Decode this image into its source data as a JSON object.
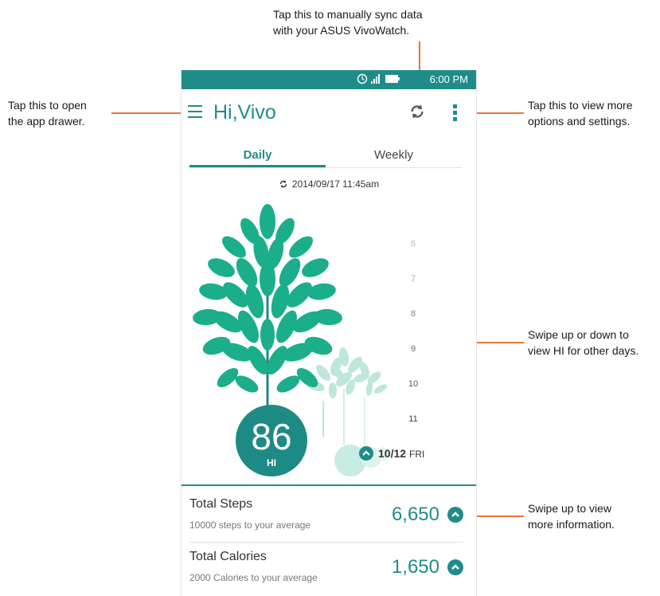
{
  "callouts": {
    "sync": "Tap this to manually sync data\nwith your ASUS VivoWatch.",
    "drawer": "Tap this to open\nthe app drawer.",
    "options": "Tap this to view more\noptions and settings.",
    "swipe_days": "Swipe up or down to\nview HI for other days.",
    "swipe_info": "Swipe up to view\nmore information."
  },
  "status_bar": {
    "time": "6:00 PM",
    "icons": "alarm-icon signal-icon battery-icon"
  },
  "app_bar": {
    "title": "Hi,Vivo",
    "icons": [
      "menu-icon",
      "sync-icon",
      "more-options-icon"
    ]
  },
  "tabs": [
    {
      "label": "Daily",
      "selected": true
    },
    {
      "label": "Weekly",
      "selected": false
    }
  ],
  "sync_time": "2014/09/17 11:45am",
  "day_scale": [
    "6",
    "7",
    "8",
    "9",
    "10",
    "11"
  ],
  "hi": {
    "value": "86",
    "label": "HI"
  },
  "selected_date": {
    "date": "10/12",
    "weekday": "FRI"
  },
  "summary": [
    {
      "title": "Total Steps",
      "subtitle": "10000 steps to your average",
      "value": "6,650"
    },
    {
      "title": "Total Calories",
      "subtitle": "2000 Calories to your average",
      "value": "1,650"
    }
  ],
  "colors": {
    "accent": "#1f8c8a",
    "callout_line": "#e8743b",
    "leaf_primary": "#1bae8a",
    "leaf_faded": "#bfe6dc"
  }
}
